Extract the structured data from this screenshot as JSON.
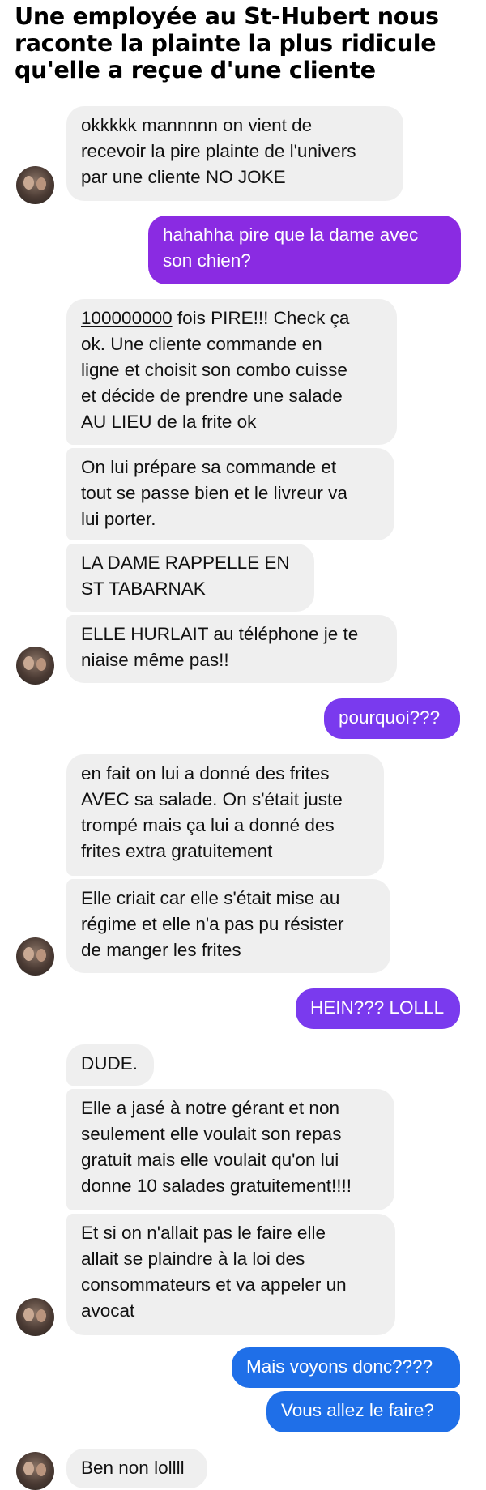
{
  "title": "Une employée au St-Hubert nous raconte la plainte la plus ridicule qu'elle a reçue d'une cliente",
  "messages": [
    {
      "side": "in",
      "text": "okkkkk mannnnn on vient de\nrecevoir la pire plainte de l'univers\npar une cliente NO JOKE"
    },
    {
      "side": "out",
      "text": "hahahha pire que la dame avec\nson chien?"
    },
    {
      "side": "in",
      "u": "100000000",
      "text": " fois PIRE!!! Check ça\nok. Une cliente commande en\nligne et choisit son combo cuisse\net décide de prendre une salade\nAU LIEU de la frite ok"
    },
    {
      "side": "in",
      "text": "On lui prépare sa commande et\ntout se passe bien et le livreur va\nlui porter."
    },
    {
      "side": "in",
      "text": "LA DAME RAPPELLE EN\nST TABARNAK"
    },
    {
      "side": "in",
      "text": "ELLE HURLAIT au téléphone je te\nniaise même pas!!"
    },
    {
      "side": "out",
      "text": "pourquoi???"
    },
    {
      "side": "in",
      "text": "en fait on lui a donné des frites\nAVEC sa salade. On s'était juste\ntrompé mais ça lui a donné des\nfrites extra gratuitement"
    },
    {
      "side": "in",
      "text": "Elle criait car elle s'était mise au\nrégime et elle n'a pas pu résister\nde manger les frites"
    },
    {
      "side": "out",
      "text": "HEIN??? LOLLL"
    },
    {
      "side": "in",
      "text": "DUDE."
    },
    {
      "side": "in",
      "text": "Elle a jasé à notre gérant et non\nseulement elle voulait son repas\ngratuit mais elle voulait qu'on lui\ndonne 10 salades gratuitement!!!!"
    },
    {
      "side": "in",
      "text": "Et si on n'allait pas le faire elle\nallait se plaindre à la loi des\nconsommateurs et va appeler un\navocat"
    },
    {
      "side": "out",
      "text": "Mais voyons donc????"
    },
    {
      "side": "out",
      "text": "Vous allez le faire?"
    },
    {
      "side": "in",
      "text": "Ben non lollll"
    }
  ]
}
